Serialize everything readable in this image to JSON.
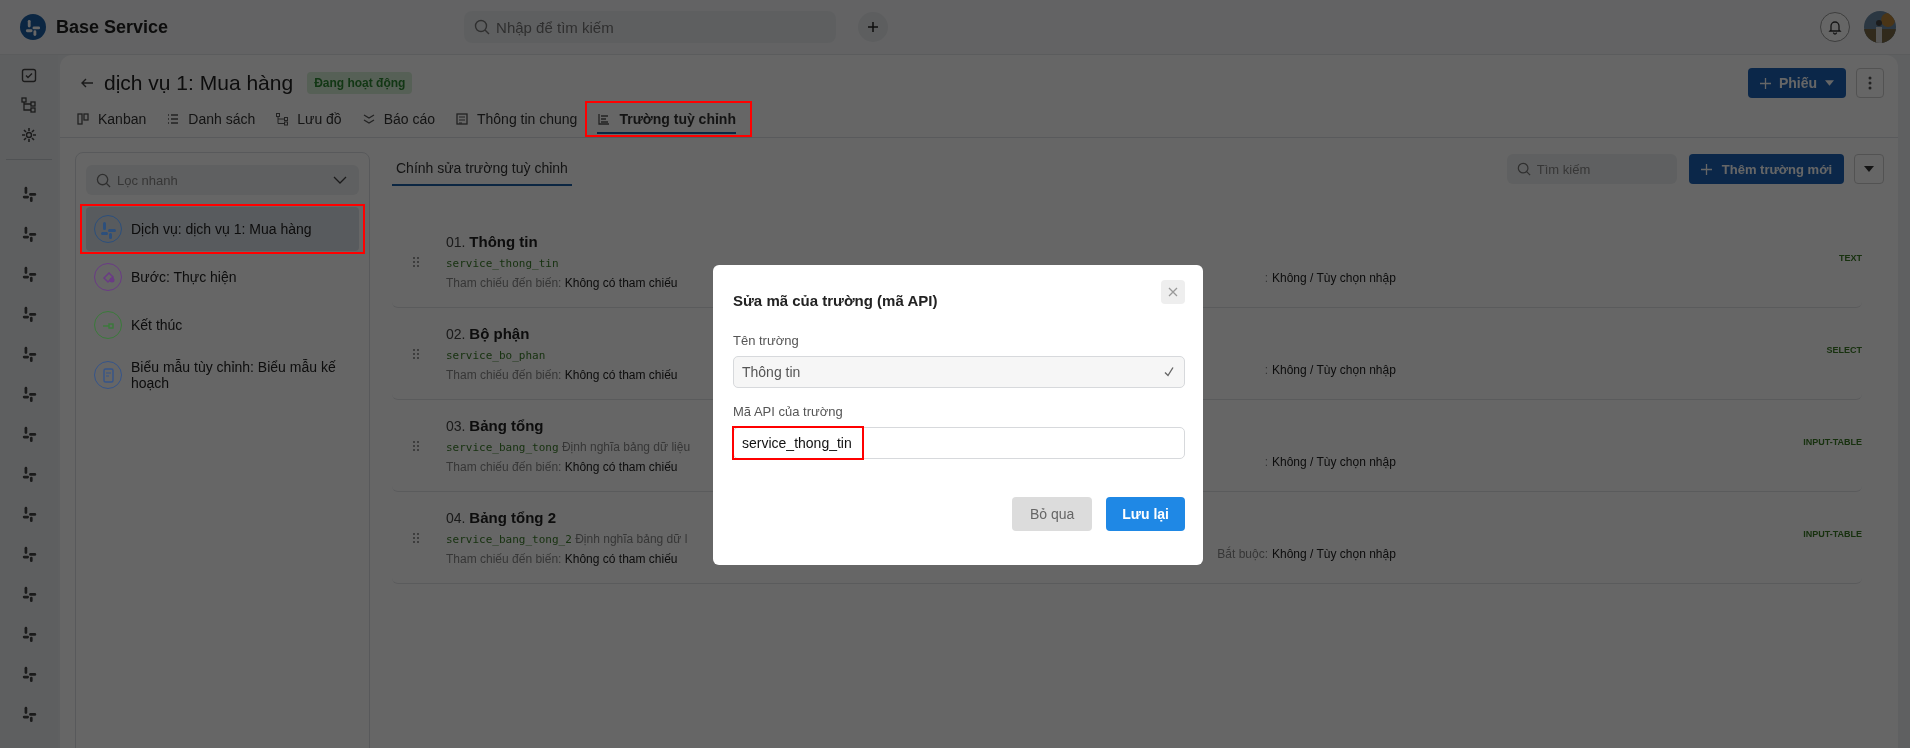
{
  "app": {
    "name": "Base Service"
  },
  "search": {
    "placeholder": "Nhập để tìm kiếm"
  },
  "page": {
    "title": "dịch vụ 1: Mua hàng",
    "status": "Đang hoạt động",
    "primary_button": "Phiếu"
  },
  "tabs": [
    {
      "label": "Kanban",
      "selected": false,
      "annotated": false
    },
    {
      "label": "Danh sách",
      "selected": false,
      "annotated": false
    },
    {
      "label": "Lưu đồ",
      "selected": false,
      "annotated": false
    },
    {
      "label": "Báo cáo",
      "selected": false,
      "annotated": false
    },
    {
      "label": "Thông tin chung",
      "selected": false,
      "annotated": false
    },
    {
      "label": "Trường tuỳ chỉnh",
      "selected": true,
      "annotated": true
    }
  ],
  "sidebar": {
    "filter_placeholder": "Lọc nhanh",
    "items": [
      {
        "label": "Dịch vụ: dịch vụ 1: Mua hàng",
        "color": "#2c4f7c",
        "selected": true,
        "annotated": true
      },
      {
        "label": "Bước: Thực hiện",
        "color": "#6a3a85",
        "selected": false,
        "annotated": false
      },
      {
        "label": "Kết thúc",
        "color": "#3a7a3a",
        "selected": false,
        "annotated": false
      },
      {
        "label": "Biểu mẫu tùy chỉnh: Biểu mẫu kế hoạch",
        "color": "#35548a",
        "selected": false,
        "annotated": false
      }
    ]
  },
  "content": {
    "tab": "Chính sửa trường tuỳ chỉnh",
    "search_placeholder": "Tìm kiếm",
    "add_button": "Thêm trường mới",
    "fields": [
      {
        "number": "01.",
        "name": "Thông tin",
        "code": "service_thong_tin",
        "reference_label": "Tham chiếu đến biến:",
        "reference": "Không có tham chiếu",
        "type": "TEXT",
        "required_label": ":",
        "required": "Không / Tùy chọn nhập"
      },
      {
        "number": "02.",
        "name": "Bộ phận",
        "code": "service_bo_phan",
        "reference_label": "Tham chiếu đến biến:",
        "reference": "Không có tham chiếu",
        "type": "SELECT",
        "required_label": ":",
        "required": "Không / Tùy chọn nhập"
      },
      {
        "number": "03.",
        "name": "Bảng tổng",
        "code": "service_bang_tong",
        "description": "Định nghĩa bảng dữ liệu",
        "reference_label": "Tham chiếu đến biến:",
        "reference": "Không có tham chiếu",
        "type": "INPUT-TABLE",
        "required_label": ":",
        "required": "Không / Tùy chọn nhập"
      },
      {
        "number": "04.",
        "name": "Bảng tổng 2",
        "code": "service_bang_tong_2",
        "description": "Định nghĩa bảng dữ l",
        "reference_label": "Tham chiếu đến biến:",
        "reference": "Không có tham chiếu",
        "type": "INPUT-TABLE",
        "required_label": "Bắt buộc:",
        "required": "Không / Tùy chọn nhập"
      }
    ]
  },
  "modal": {
    "title": "Sửa mã của trường (mã API)",
    "name_label": "Tên trường",
    "name_value": "Thông tin",
    "api_label": "Mã API của trường",
    "api_value": "service_thong_tin",
    "api_annotated": true,
    "cancel": "Bỏ qua",
    "save": "Lưu lại"
  }
}
